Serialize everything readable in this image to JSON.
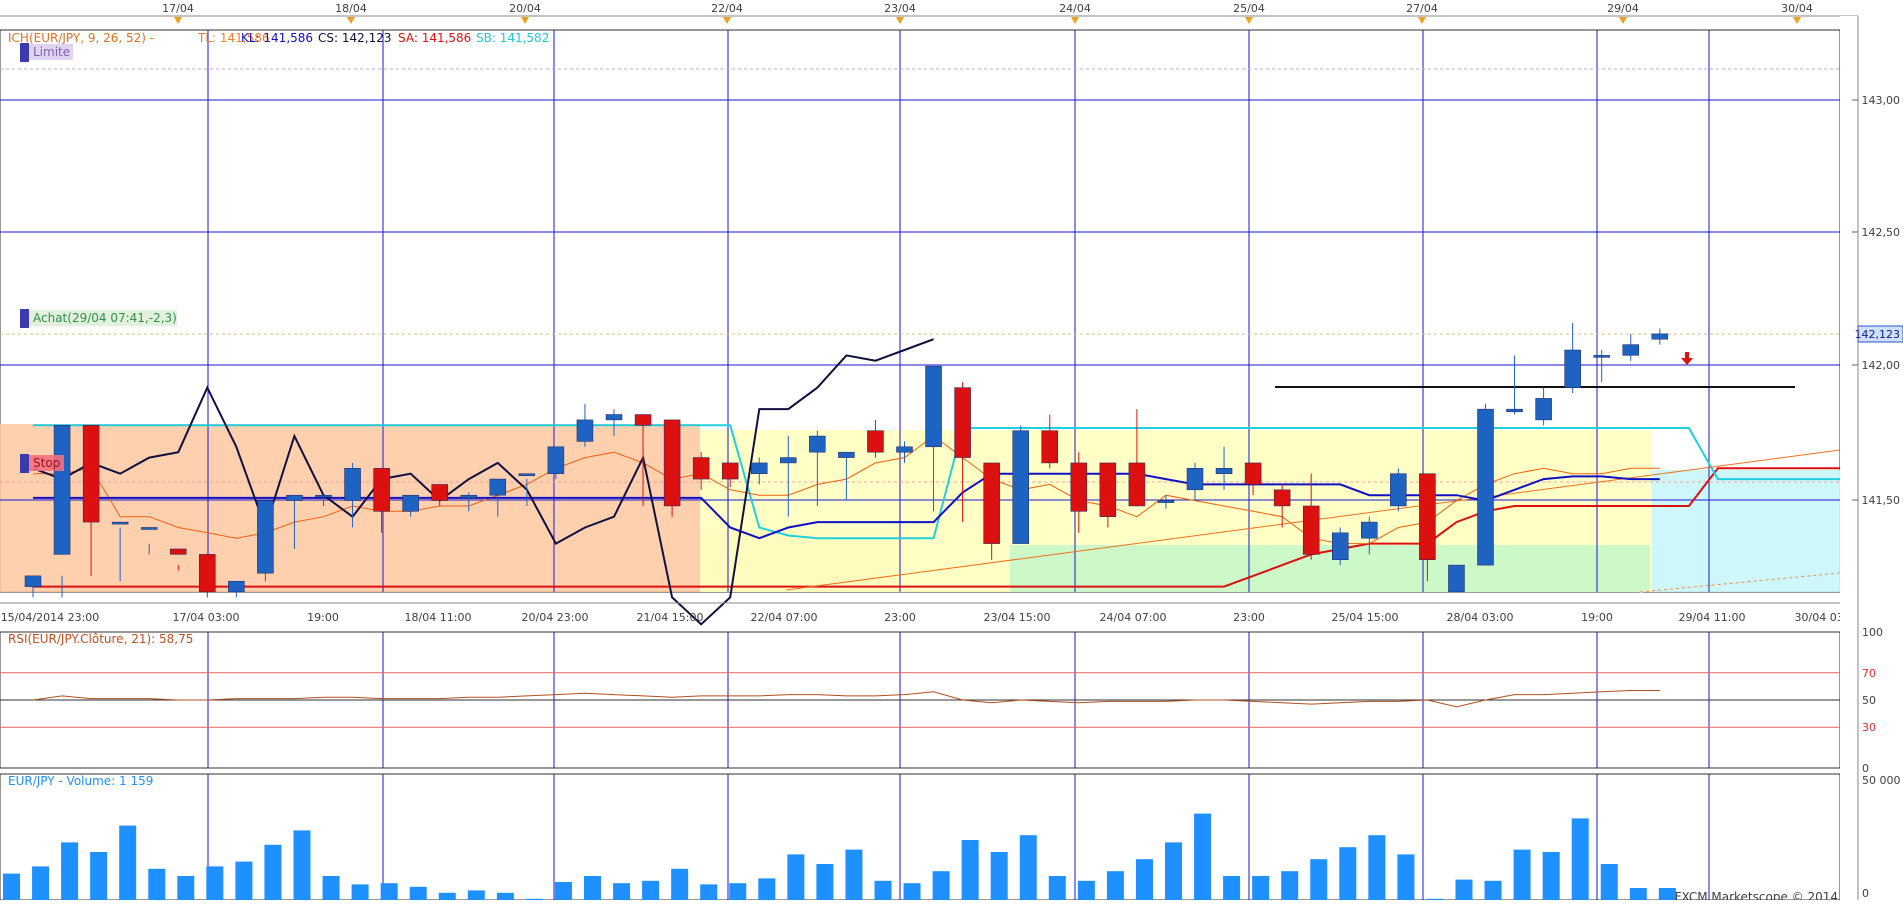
{
  "top_dates": [
    "17/04",
    "18/04",
    "20/04",
    "22/04",
    "23/04",
    "24/04",
    "25/04",
    "27/04",
    "29/04",
    "30/04"
  ],
  "price_axis": {
    "min": 141.16,
    "max": 143.25,
    "ticks": [
      "143,00",
      "142,50",
      "142,00",
      "141,50"
    ],
    "current_label": "142,123"
  },
  "time_labels": [
    "15/04/2014 23:00",
    "17/04 03:00",
    "19:00",
    "18/04 11:00",
    "20/04 23:00",
    "21/04 15:00",
    "22/04 07:00",
    "23:00",
    "23/04 15:00",
    "24/04 07:00",
    "23:00",
    "25/04 15:00",
    "28/04 03:00",
    "19:00",
    "29/04 11:00",
    "30/04 03:00"
  ],
  "price_legend": {
    "ich": "ICH(EUR/JPY, 9, 26, 52) -",
    "tl": "TL: 141,586",
    "kl": "KL: 141,586",
    "cs": "CS: 142,123",
    "sa": "SA: 141,586",
    "sb": "SB: 141,582"
  },
  "order_labels": {
    "limit": "Limite",
    "buy": "Achat(29/04 07:41,-2,3)",
    "stop": "Stop"
  },
  "rsi": {
    "legend": "RSI(EUR/JPY.Clôture, 21): 58,75",
    "ticks": [
      "100",
      "70",
      "50",
      "30",
      "0"
    ]
  },
  "volume": {
    "legend": "EUR/JPY - Volume: 1 159",
    "ticks": [
      "50 000",
      "0"
    ],
    "max": 50000
  },
  "watermark": "FXCM Marketscope © 2014",
  "colors": {
    "grid": "#1a1ad0",
    "bull": "#1f63c2",
    "bear": "#dd1010",
    "volume": "#1e90ff",
    "rsi": "#b05020",
    "kijun": "#1010c8",
    "tenkan": "#f06010",
    "chikou": "#101040"
  },
  "chart_data": {
    "type": "candlestick",
    "candles": [
      [
        141.18,
        141.22,
        141.14,
        141.18
      ],
      [
        141.3,
        141.78,
        141.14,
        141.22
      ],
      [
        141.78,
        141.42,
        141.22,
        141.44
      ],
      [
        141.42,
        141.42,
        141.2,
        141.4
      ],
      [
        141.4,
        141.4,
        141.3,
        141.34
      ],
      [
        141.32,
        141.3,
        141.24,
        141.26
      ],
      [
        141.3,
        141.16,
        141.14,
        141.16
      ],
      [
        141.16,
        141.2,
        141.14,
        141.18
      ],
      [
        141.23,
        141.5,
        141.2,
        141.5
      ],
      [
        141.5,
        141.52,
        141.32,
        141.52
      ],
      [
        141.52,
        141.52,
        141.48,
        141.52
      ],
      [
        141.5,
        141.62,
        141.4,
        141.64
      ],
      [
        141.62,
        141.46,
        141.38,
        141.46
      ],
      [
        141.46,
        141.52,
        141.44,
        141.52
      ],
      [
        141.56,
        141.5,
        141.48,
        141.54
      ],
      [
        141.51,
        141.52,
        141.46,
        141.53
      ],
      [
        141.52,
        141.58,
        141.44,
        141.58
      ],
      [
        141.6,
        141.6,
        141.48,
        141.58
      ],
      [
        141.6,
        141.7,
        141.58,
        141.7
      ],
      [
        141.72,
        141.8,
        141.7,
        141.86
      ],
      [
        141.8,
        141.82,
        141.74,
        141.84
      ],
      [
        141.82,
        141.78,
        141.48,
        141.78
      ],
      [
        141.8,
        141.48,
        141.44,
        141.5
      ],
      [
        141.66,
        141.58,
        141.54,
        141.68
      ],
      [
        141.64,
        141.58,
        141.55,
        141.64
      ],
      [
        141.6,
        141.64,
        141.56,
        141.66
      ],
      [
        141.64,
        141.66,
        141.44,
        141.74
      ],
      [
        141.68,
        141.74,
        141.48,
        141.76
      ],
      [
        141.66,
        141.68,
        141.5,
        141.66
      ],
      [
        141.76,
        141.68,
        141.66,
        141.8
      ],
      [
        141.68,
        141.7,
        141.64,
        141.72
      ],
      [
        141.7,
        142.0,
        141.46,
        142.0
      ],
      [
        141.92,
        141.66,
        141.42,
        141.94
      ],
      [
        141.64,
        141.34,
        141.28,
        141.64
      ],
      [
        141.34,
        141.76,
        141.34,
        141.78
      ],
      [
        141.76,
        141.64,
        141.62,
        141.82
      ],
      [
        141.64,
        141.46,
        141.38,
        141.68
      ],
      [
        141.64,
        141.44,
        141.4,
        141.64
      ],
      [
        141.64,
        141.48,
        141.48,
        141.84
      ],
      [
        141.5,
        141.5,
        141.47,
        141.52
      ],
      [
        141.54,
        141.62,
        141.5,
        141.64
      ],
      [
        141.6,
        141.62,
        141.54,
        141.7
      ],
      [
        141.64,
        141.56,
        141.52,
        141.64
      ],
      [
        141.54,
        141.48,
        141.4,
        141.56
      ],
      [
        141.48,
        141.3,
        141.28,
        141.6
      ],
      [
        141.28,
        141.38,
        141.26,
        141.4
      ],
      [
        141.36,
        141.42,
        141.3,
        141.44
      ],
      [
        141.48,
        141.6,
        141.46,
        141.62
      ],
      [
        141.6,
        141.28,
        141.2,
        141.6
      ],
      [
        141.16,
        141.26,
        141.16,
        141.26
      ],
      [
        141.26,
        141.84,
        141.26,
        141.86
      ],
      [
        141.83,
        141.84,
        141.82,
        142.04
      ],
      [
        141.8,
        141.88,
        141.78,
        141.92
      ],
      [
        141.92,
        142.06,
        141.9,
        142.16
      ],
      [
        142.04,
        142.04,
        141.94,
        142.06
      ],
      [
        142.04,
        142.08,
        142.02,
        142.12
      ],
      [
        142.1,
        142.12,
        142.08,
        142.14
      ]
    ],
    "kijun": [
      141.51,
      141.51,
      141.51,
      141.51,
      141.51,
      141.51,
      141.51,
      141.51,
      141.51,
      141.51,
      141.51,
      141.51,
      141.51,
      141.51,
      141.51,
      141.51,
      141.51,
      141.51,
      141.51,
      141.51,
      141.51,
      141.51,
      141.51,
      141.51,
      141.4,
      141.36,
      141.4,
      141.42,
      141.42,
      141.42,
      141.42,
      141.42,
      141.53,
      141.6,
      141.6,
      141.6,
      141.6,
      141.6,
      141.6,
      141.58,
      141.56,
      141.56,
      141.56,
      141.56,
      141.56,
      141.56,
      141.52,
      141.52,
      141.52,
      141.52,
      141.5,
      141.54,
      141.58,
      141.59,
      141.59,
      141.58,
      141.58
    ],
    "tenkan": [
      141.6,
      141.6,
      141.62,
      141.44,
      141.44,
      141.4,
      141.38,
      141.36,
      141.38,
      141.42,
      141.44,
      141.48,
      141.46,
      141.46,
      141.48,
      141.48,
      141.52,
      141.56,
      141.62,
      141.66,
      141.68,
      141.64,
      141.58,
      141.6,
      141.54,
      141.52,
      141.52,
      141.56,
      141.58,
      141.64,
      141.66,
      141.74,
      141.66,
      141.58,
      141.54,
      141.56,
      141.5,
      141.48,
      141.44,
      141.52,
      141.5,
      141.48,
      141.46,
      141.44,
      141.36,
      141.34,
      141.34,
      141.4,
      141.42,
      141.5,
      141.56,
      141.6,
      141.62,
      141.6,
      141.6,
      141.62,
      141.62
    ],
    "chikou": [
      141.62,
      141.58,
      141.64,
      141.6,
      141.66,
      141.68,
      141.92,
      141.7,
      141.4,
      141.74,
      141.52,
      141.44,
      141.58,
      141.6,
      141.5,
      141.58,
      141.64,
      141.54,
      141.34,
      141.4,
      141.44,
      141.66,
      141.14,
      141.04,
      141.14,
      141.84,
      141.84,
      141.92,
      142.04,
      142.02,
      142.06,
      142.1
    ],
    "senkou_a": [
      141.18,
      141.18,
      141.18,
      141.18,
      141.18,
      141.18,
      141.18,
      141.18,
      141.18,
      141.18,
      141.18,
      141.18,
      141.18,
      141.18,
      141.18,
      141.18,
      141.18,
      141.18,
      141.18,
      141.18,
      141.18,
      141.18,
      141.18,
      141.18,
      141.18,
      141.18,
      141.18,
      141.18,
      141.18,
      141.18,
      141.18,
      141.18,
      141.18,
      141.18,
      141.18,
      141.18,
      141.18,
      141.18,
      141.18,
      141.18,
      141.18,
      141.18,
      141.22,
      141.26,
      141.3,
      141.32,
      141.34,
      141.34,
      141.34,
      141.42,
      141.46,
      141.48,
      141.48,
      141.48,
      141.48,
      141.48,
      141.48,
      141.48,
      141.62,
      141.62,
      141.62,
      141.62,
      141.62,
      141.62
    ],
    "senkou_b": [
      141.78,
      141.78,
      141.78,
      141.78,
      141.78,
      141.78,
      141.78,
      141.78,
      141.78,
      141.78,
      141.78,
      141.78,
      141.78,
      141.78,
      141.78,
      141.78,
      141.78,
      141.78,
      141.78,
      141.78,
      141.78,
      141.78,
      141.78,
      141.78,
      141.78,
      141.4,
      141.37,
      141.36,
      141.36,
      141.36,
      141.36,
      141.36,
      141.77,
      141.77,
      141.77,
      141.77,
      141.77,
      141.77,
      141.77,
      141.77,
      141.77,
      141.77,
      141.77,
      141.77,
      141.77,
      141.77,
      141.77,
      141.77,
      141.77,
      141.77,
      141.77,
      141.77,
      141.77,
      141.77,
      141.77,
      141.77,
      141.77,
      141.77,
      141.58,
      141.58,
      141.58,
      141.58,
      141.58,
      141.58
    ],
    "rsi": [
      50,
      53,
      51,
      51,
      51,
      50,
      50,
      51,
      51,
      51,
      52,
      52,
      51,
      51,
      51,
      52,
      52,
      53,
      54,
      55,
      54,
      53,
      52,
      53,
      53,
      53,
      54,
      54,
      53,
      53,
      54,
      56,
      50,
      48,
      50,
      49,
      48,
      49,
      49,
      49,
      50,
      50,
      49,
      48,
      47,
      48,
      49,
      49,
      50,
      45,
      50,
      54,
      54,
      55,
      56,
      57,
      57
    ],
    "volumes": [
      11000,
      14000,
      24000,
      20000,
      31000,
      13000,
      10000,
      14000,
      16000,
      23000,
      29000,
      10000,
      6500,
      7000,
      5500,
      3000,
      4000,
      3000,
      500,
      7500,
      10000,
      7000,
      8000,
      13000,
      6500,
      7000,
      9000,
      19000,
      15000,
      21000,
      8000,
      7000,
      12000,
      25000,
      20000,
      27000,
      10000,
      8000,
      12000,
      17000,
      24000,
      36000,
      10000,
      10000,
      12000,
      17000,
      22000,
      27000,
      19000,
      500,
      8500,
      8000,
      21000,
      20000,
      34000,
      15000,
      5000,
      5000
    ]
  }
}
